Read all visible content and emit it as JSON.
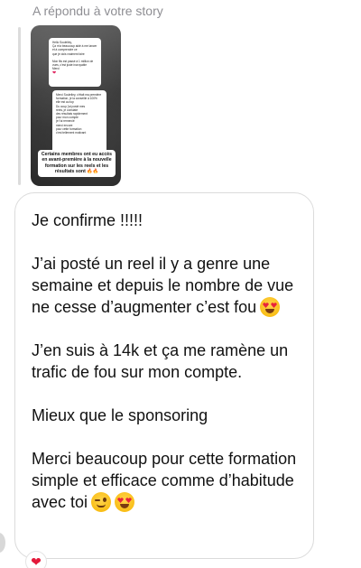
{
  "reply_label": "A répondu à votre story",
  "story": {
    "card_one_lines": [
      "Hello Souleiley,",
      "Ça m'a beaucoup aidé à me lancer",
      "et à comprendre ce",
      "que je dois vraiment faire",
      "",
      "Mon fils est passé à 1 million de",
      "vues, c'est juste incroyable",
      "Merci"
    ],
    "card_two_lines": [
      "Merci Souleiley, c'était ma première",
      "formation, je la conseille à 100%",
      "elle est au top",
      "Du coup j'ai posté mes",
      "reels, je constate",
      "des résultats rapidement",
      "pour mon compte",
      "je t'ai remercié",
      "merci encore",
      "pour cette formation",
      "c'est tellement motivant"
    ],
    "caption": "Certains membres ont eu accès en avant-première à la nouvelle formation sur les reels et les résultats sont 🔥🔥"
  },
  "message": {
    "paragraphs": [
      "Je confirme !!!!!",
      "J’ai posté un reel il y a genre une semaine et depuis le nombre de vue ne cesse d’augmenter c’est fou",
      "J’en suis à 14k et ça me ramène un trafic de fou sur mon compte.",
      "Mieux que le sponsoring",
      "Merci beaucoup pour cette formation simple et efficace comme d’habitude avec toi"
    ]
  },
  "reaction": "heart-reaction",
  "colors": {
    "bubble_border": "#dbdbdb",
    "label_gray": "#8e8e93",
    "heart": "#e3193a"
  }
}
